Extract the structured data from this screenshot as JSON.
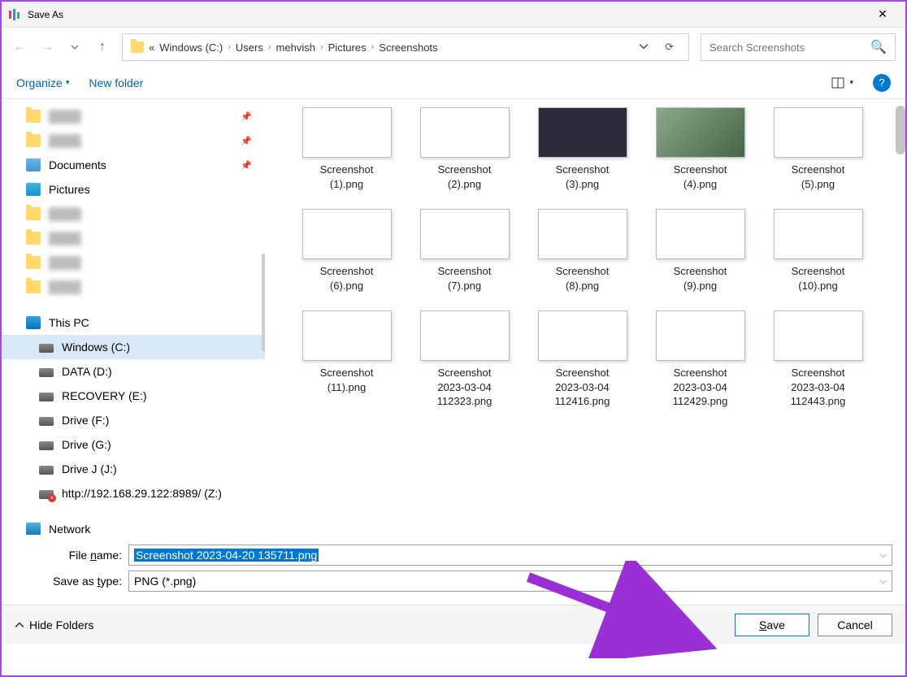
{
  "window": {
    "title": "Save As"
  },
  "nav": {
    "breadcrumb_prefix": "«",
    "breadcrumbs": [
      "Windows (C:)",
      "Users",
      "mehvish",
      "Pictures",
      "Screenshots"
    ],
    "search_placeholder": "Search Screenshots"
  },
  "toolbar": {
    "organize": "Organize",
    "new_folder": "New folder"
  },
  "sidebar": {
    "quick": [
      {
        "label": "Documents",
        "icon": "doc",
        "pin": true
      },
      {
        "label": "Pictures",
        "icon": "pic",
        "pin": false
      }
    ],
    "this_pc": "This PC",
    "drives": [
      {
        "label": "Windows (C:)",
        "icon": "drive",
        "selected": true
      },
      {
        "label": "DATA (D:)",
        "icon": "drive"
      },
      {
        "label": "RECOVERY (E:)",
        "icon": "drive"
      },
      {
        "label": "Drive (F:)",
        "icon": "drive"
      },
      {
        "label": "Drive (G:)",
        "icon": "drive"
      },
      {
        "label": "Drive J (J:)",
        "icon": "drive"
      },
      {
        "label": "http://192.168.29.122:8989/ (Z:)",
        "icon": "netdrive"
      }
    ],
    "network": "Network"
  },
  "files": [
    {
      "name": "Screenshot (1).png"
    },
    {
      "name": "Screenshot (2).png"
    },
    {
      "name": "Screenshot (3).png"
    },
    {
      "name": "Screenshot (4).png"
    },
    {
      "name": "Screenshot (5).png"
    },
    {
      "name": "Screenshot (6).png"
    },
    {
      "name": "Screenshot (7).png"
    },
    {
      "name": "Screenshot (8).png"
    },
    {
      "name": "Screenshot (9).png"
    },
    {
      "name": "Screenshot (10).png"
    },
    {
      "name": "Screenshot (11).png"
    },
    {
      "name": "Screenshot 2023-03-04 112323.png"
    },
    {
      "name": "Screenshot 2023-03-04 112416.png"
    },
    {
      "name": "Screenshot 2023-03-04 112429.png"
    },
    {
      "name": "Screenshot 2023-03-04 112443.png"
    }
  ],
  "form": {
    "file_name_label": "File name:",
    "file_name_value": "Screenshot 2023-04-20 135711.png",
    "save_type_label": "Save as type:",
    "save_type_value": "PNG (*.png)"
  },
  "footer": {
    "hide_folders": "Hide Folders",
    "save": "Save",
    "cancel": "Cancel"
  }
}
